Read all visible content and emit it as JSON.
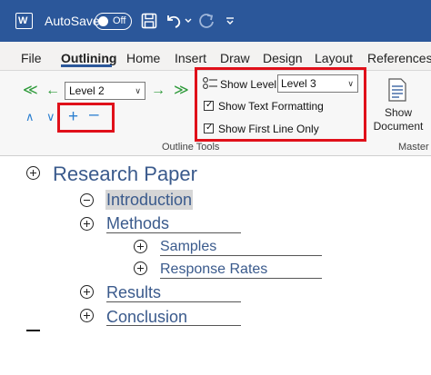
{
  "titlebar": {
    "autosave_label": "AutoSave",
    "autosave_state": "Off",
    "app_icon_letter": "W",
    "accent_color": "#2b579a"
  },
  "tabs": [
    "File",
    "Outlining",
    "Home",
    "Insert",
    "Draw",
    "Design",
    "Layout",
    "References"
  ],
  "active_tab": "Outlining",
  "ribbon": {
    "level_value": "Level 2",
    "show_level_label": "Show Level:",
    "show_level_value": "Level 3",
    "show_text_formatting": {
      "label": "Show Text Formatting",
      "checked": true
    },
    "show_first_line_only": {
      "label": "Show First Line Only",
      "checked": true
    },
    "group_outline_tools": "Outline Tools",
    "show_document_line1": "Show",
    "show_document_line2": "Document",
    "group_master": "Master",
    "icons": [
      "promote-to-heading1-icon",
      "promote-icon",
      "demote-icon",
      "demote-to-body-icon",
      "move-up-icon",
      "move-down-icon",
      "expand-icon",
      "collapse-icon",
      "show-level-icon",
      "show-document-icon"
    ],
    "highlight_color": "#e0101a"
  },
  "document": {
    "items": [
      {
        "text": "Research Paper",
        "level": 1,
        "symbol": "plus"
      },
      {
        "text": "Introduction",
        "level": 2,
        "symbol": "minus",
        "selected": true
      },
      {
        "text": "Methods",
        "level": 2,
        "symbol": "plus"
      },
      {
        "text": "Samples",
        "level": 3,
        "symbol": "plus"
      },
      {
        "text": "Response Rates",
        "level": 3,
        "symbol": "plus"
      },
      {
        "text": "Results",
        "level": 2,
        "symbol": "plus"
      },
      {
        "text": "Conclusion",
        "level": 2,
        "symbol": "plus"
      }
    ],
    "heading_color": "#3a5a8c"
  }
}
